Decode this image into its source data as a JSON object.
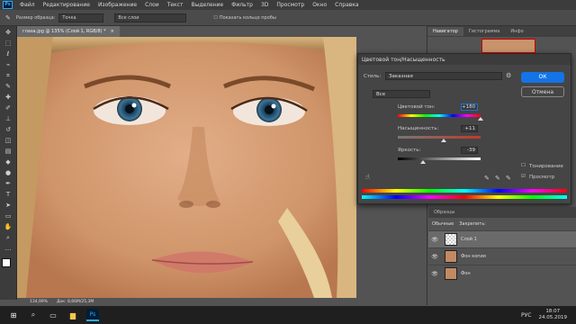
{
  "menu": [
    "Файл",
    "Редактирование",
    "Изображение",
    "Слои",
    "Текст",
    "Выделение",
    "Фильтр",
    "3D",
    "Просмотр",
    "Окно",
    "Справка"
  ],
  "options": {
    "size_label": "Размер образца:",
    "size_value": "Точка",
    "sample_value": "Все слои",
    "show_ring": "Показать кольцо пробы"
  },
  "document": {
    "tab_title": "глаза.jpg @ 135% (Слой 1, RGB/8) *",
    "close": "×"
  },
  "status": {
    "zoom": "134,99%",
    "doc": "Док: 8,66M/25,3M"
  },
  "panel_tabs": [
    "Навигатор",
    "Гистограмма",
    "Инфо"
  ],
  "dialog": {
    "title": "Цветовой тон/Насыщенность",
    "preset_label": "Стиль:",
    "preset_value": "Заказная",
    "channel_value": "Все",
    "hue_label": "Цветовой тон:",
    "hue_value": "+180",
    "sat_label": "Насыщенность:",
    "sat_value": "+11",
    "light_label": "Яркость:",
    "light_value": "-39",
    "ok_label": "ОК",
    "cancel_label": "Отмена",
    "colorize_label": "Тонирование",
    "preview_label": "Просмотр",
    "hue_level": 1.0,
    "sat_level": 0.55,
    "light_level": 0.3
  },
  "layers_panel": {
    "tab": "Образцы",
    "kind_label": "Обычные",
    "lock_label": "Закрепить:",
    "items": [
      {
        "name": "Слой 1",
        "selected": true
      },
      {
        "name": "Фон копия",
        "selected": false
      },
      {
        "name": "Фон",
        "selected": false
      }
    ]
  },
  "taskbar": {
    "time": "18:07",
    "date": "24.05.2019",
    "lang": "РУС"
  },
  "colors": {
    "accent": "#31a8ff",
    "ok_button": "#1473e6"
  }
}
